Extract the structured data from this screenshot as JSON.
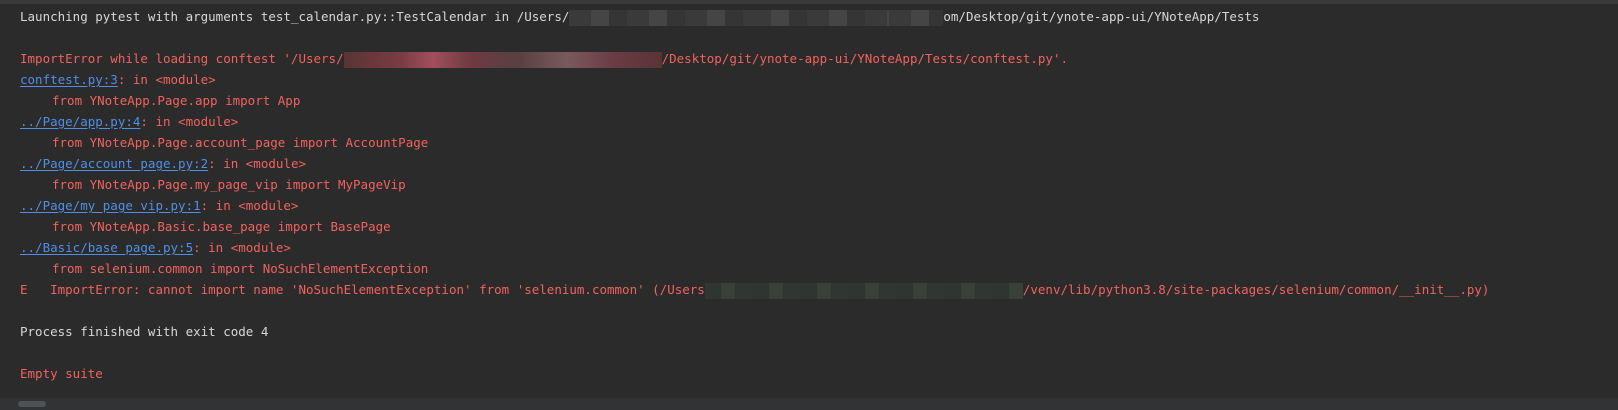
{
  "console": {
    "launch_prefix": "Launching pytest with arguments test_calendar.py::TestCalendar in /Users/",
    "launch_suffix": "om/Desktop/git/ynote-app-ui/YNoteApp/Tests",
    "import_error_prefix": "ImportError while loading conftest '/Users/",
    "import_error_suffix": "/Desktop/git/ynote-app-ui/YNoteApp/Tests/conftest.py'.",
    "trace": [
      {
        "link": "conftest.py:3",
        "context": ": in <module>",
        "code": "from YNoteApp.Page.app import App"
      },
      {
        "link": "../Page/app.py:4",
        "context": ": in <module>",
        "code": "from YNoteApp.Page.account_page import AccountPage"
      },
      {
        "link": "../Page/account_page.py:2",
        "context": ": in <module>",
        "code": "from YNoteApp.Page.my_page_vip import MyPageVip"
      },
      {
        "link": "../Page/my_page_vip.py:1",
        "context": ": in <module>",
        "code": "from YNoteApp.Basic.base_page import BasePage"
      },
      {
        "link": "../Basic/base_page.py:5",
        "context": ": in <module>",
        "code": "from selenium.common import NoSuchElementException"
      }
    ],
    "final_error_prefix": "E   ImportError: cannot import name 'NoSuchElementException' from 'selenium.common' (/Users",
    "final_error_suffix": "/venv/lib/python3.8/site-packages/selenium/common/__init__.py)",
    "process_finished": "Process finished with exit code 4",
    "empty_suite": "Empty suite"
  },
  "colors": {
    "background": "#2b2b2b",
    "plain_text": "#d7d7d7",
    "error_text": "#f1625e",
    "link_text": "#4f8fe6"
  }
}
